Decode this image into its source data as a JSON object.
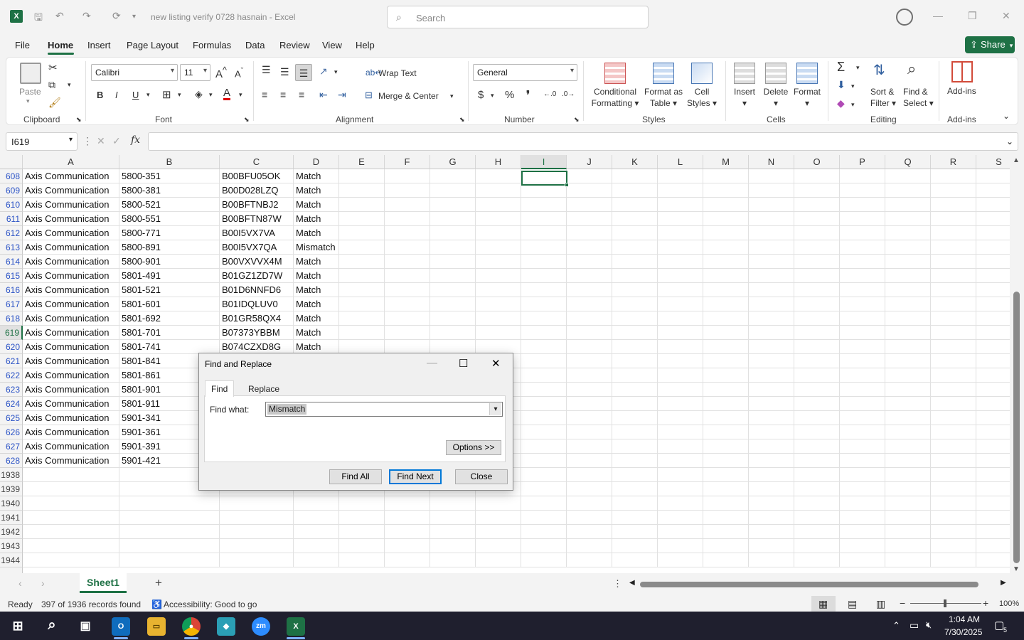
{
  "app": {
    "title": "new listing verify 0728 hasnain  -  Excel",
    "search_placeholder": "Search",
    "accent": "#1e7145"
  },
  "menu": {
    "tabs": [
      "File",
      "Home",
      "Insert",
      "Page Layout",
      "Formulas",
      "Data",
      "Review",
      "View",
      "Help"
    ],
    "active": "Home",
    "share_label": "Share"
  },
  "ribbon": {
    "paste_label": "Paste",
    "font_name": "Calibri",
    "font_size": "11",
    "wrap_text": "Wrap Text",
    "merge_center": "Merge & Center",
    "number_format": "General",
    "conditional_formatting": [
      "Conditional",
      "Formatting"
    ],
    "format_as_table": [
      "Format as",
      "Table"
    ],
    "cell_styles": [
      "Cell",
      "Styles"
    ],
    "insert": "Insert",
    "delete": "Delete",
    "format": "Format",
    "sort_filter": [
      "Sort &",
      "Filter"
    ],
    "find_select": [
      "Find &",
      "Select"
    ],
    "add_ins": "Add-ins",
    "groups": {
      "clipboard": "Clipboard",
      "font": "Font",
      "alignment": "Alignment",
      "number": "Number",
      "styles": "Styles",
      "cells": "Cells",
      "editing": "Editing",
      "addins": "Add-ins"
    }
  },
  "formula_bar": {
    "name_box": "I619",
    "fx": "fx",
    "content": ""
  },
  "grid": {
    "columns": [
      "A",
      "B",
      "C",
      "D",
      "E",
      "F",
      "G",
      "H",
      "I",
      "J",
      "K",
      "L",
      "M",
      "N",
      "O",
      "P",
      "Q",
      "R",
      "S"
    ],
    "selected_column": "I",
    "selected_row": "619",
    "rows": [
      {
        "num": "608",
        "a": "Axis Communication",
        "b": "5800-351",
        "c": "B00BFU05OK",
        "d": "Match"
      },
      {
        "num": "609",
        "a": "Axis Communication",
        "b": "5800-381",
        "c": "B00D028LZQ",
        "d": "Match"
      },
      {
        "num": "610",
        "a": "Axis Communication",
        "b": "5800-521",
        "c": "B00BFTNBJ2",
        "d": "Match"
      },
      {
        "num": "611",
        "a": "Axis Communication",
        "b": "5800-551",
        "c": "B00BFTN87W",
        "d": "Match"
      },
      {
        "num": "612",
        "a": "Axis Communication",
        "b": "5800-771",
        "c": "B00I5VX7VA",
        "d": "Match"
      },
      {
        "num": "613",
        "a": "Axis Communication",
        "b": "5800-891",
        "c": "B00I5VX7QA",
        "d": "Mismatch"
      },
      {
        "num": "614",
        "a": "Axis Communication",
        "b": "5800-901",
        "c": "B00VXVVX4M",
        "d": "Match"
      },
      {
        "num": "615",
        "a": "Axis Communication",
        "b": "5801-491",
        "c": "B01GZ1ZD7W",
        "d": "Match"
      },
      {
        "num": "616",
        "a": "Axis Communication",
        "b": "5801-521",
        "c": "B01D6NNFD6",
        "d": "Match"
      },
      {
        "num": "617",
        "a": "Axis Communication",
        "b": "5801-601",
        "c": "B01IDQLUV0",
        "d": "Match"
      },
      {
        "num": "618",
        "a": "Axis Communication",
        "b": "5801-692",
        "c": "B01GR58QX4",
        "d": "Match"
      },
      {
        "num": "619",
        "a": "Axis Communication",
        "b": "5801-701",
        "c": "B07373YBBM",
        "d": "Match"
      },
      {
        "num": "620",
        "a": "Axis Communication",
        "b": "5801-741",
        "c": "B074CZXD8G",
        "d": "Match"
      },
      {
        "num": "621",
        "a": "Axis Communication",
        "b": "5801-841",
        "c": "",
        "d": ""
      },
      {
        "num": "622",
        "a": "Axis Communication",
        "b": "5801-861",
        "c": "",
        "d": ""
      },
      {
        "num": "623",
        "a": "Axis Communication",
        "b": "5801-901",
        "c": "",
        "d": ""
      },
      {
        "num": "624",
        "a": "Axis Communication",
        "b": "5801-911",
        "c": "",
        "d": ""
      },
      {
        "num": "625",
        "a": "Axis Communication",
        "b": "5901-341",
        "c": "",
        "d": ""
      },
      {
        "num": "626",
        "a": "Axis Communication",
        "b": "5901-361",
        "c": "",
        "d": ""
      },
      {
        "num": "627",
        "a": "Axis Communication",
        "b": "5901-391",
        "c": "",
        "d": ""
      },
      {
        "num": "628",
        "a": "Axis Communication",
        "b": "5901-421",
        "c": "",
        "d": ""
      },
      {
        "num": "1938",
        "a": "",
        "b": "",
        "c": "",
        "d": ""
      },
      {
        "num": "1939",
        "a": "",
        "b": "",
        "c": "",
        "d": ""
      },
      {
        "num": "1940",
        "a": "",
        "b": "",
        "c": "",
        "d": ""
      },
      {
        "num": "1941",
        "a": "",
        "b": "",
        "c": "",
        "d": ""
      },
      {
        "num": "1942",
        "a": "",
        "b": "",
        "c": "",
        "d": ""
      },
      {
        "num": "1943",
        "a": "",
        "b": "",
        "c": "",
        "d": ""
      },
      {
        "num": "1944",
        "a": "",
        "b": "",
        "c": "",
        "d": ""
      }
    ]
  },
  "sheets": {
    "tabs": [
      "Sheet1"
    ],
    "add_label": "+"
  },
  "status": {
    "ready": "Ready",
    "records": "397 of 1936 records found",
    "accessibility": "Accessibility: Good to go",
    "zoom": "100%"
  },
  "dialog": {
    "title": "Find and Replace",
    "tab_find": "Find",
    "tab_replace": "Replace",
    "find_what_label": "Find what:",
    "find_what_value": "Mismatch",
    "options_label": "Options >>",
    "find_all": "Find All",
    "find_next": "Find Next",
    "close": "Close"
  },
  "taskbar": {
    "time": "1:04 AM",
    "date": "7/30/2025",
    "notification_count": "5",
    "apps": [
      "start",
      "search",
      "task-view",
      "outlook",
      "file-explorer",
      "chrome",
      "app",
      "zoom",
      "excel"
    ]
  }
}
